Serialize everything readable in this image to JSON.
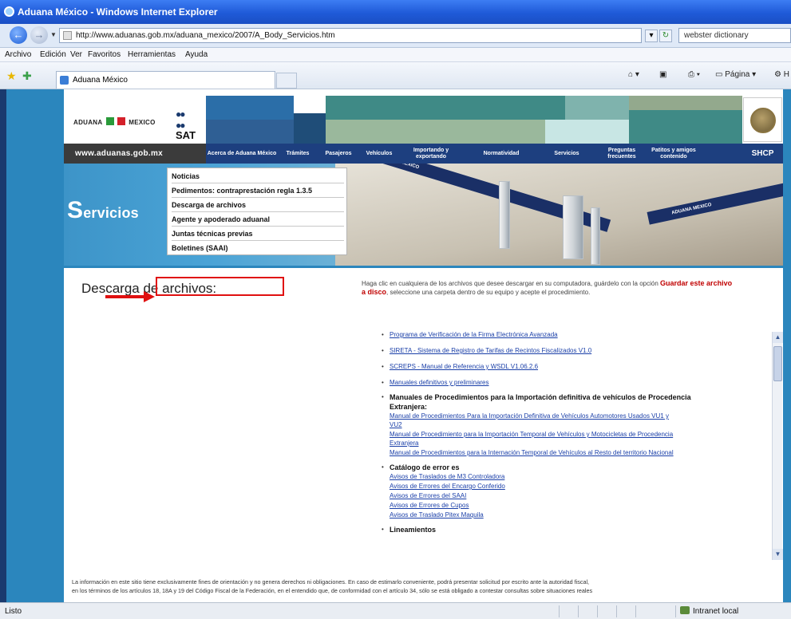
{
  "window": {
    "title": "Aduana México - Windows Internet Explorer"
  },
  "address": {
    "url": "http://www.aduanas.gob.mx/aduana_mexico/2007/A_Body_Servicios.htm",
    "search_value": "webster dictionary"
  },
  "menubar": [
    "Archivo",
    "Edición",
    "Ver",
    "Favoritos",
    "Herramientas",
    "Ayuda"
  ],
  "tab": {
    "label": "Aduana México"
  },
  "toolbar": {
    "page_label": "Página"
  },
  "site": {
    "logo_left": "ADUANA",
    "logo_right": "MEXICO",
    "sat_label": "SAT",
    "url_text": "www.aduanas.gob.mx",
    "shcp": "SHCP",
    "nav": [
      "Acerca de Aduana México",
      "Trámites",
      "Pasajeros",
      "Vehículos",
      "Importando y exportando",
      "Normatividad",
      "Servicios",
      "Preguntas frecuentes",
      "Patitos y amigos contenido"
    ],
    "banner_title_initial": "S",
    "banner_title_rest": "ervicios",
    "tape_text": "ADUANA MEXICO",
    "submenu": [
      "Noticias",
      "Pedimentos: contraprestación regla 1.3.5",
      "Descarga de archivos",
      "Agente y apoderado aduanal",
      "Juntas técnicas previas",
      "Boletines (SAAI)"
    ]
  },
  "content": {
    "heading": "Descarga de archivos:",
    "intro_before": "Haga clic en cualquiera de los archivos que desee descargar en su computadora, guárdelo con la opción",
    "intro_bold": "Guardar este archivo a disco",
    "intro_after": ", seleccione una carpeta dentro de su equipo y acepte el procedimiento.",
    "links": [
      "Programa de Verificación de la Firma Electrónica Avanzada",
      "SIRETA - Sistema de Registro de Tarifas de Recintos Fiscalizados V1.0",
      "SCREPS - Manual de Referencia y WSDL V1.06.2.6",
      "Manuales definitivos y preliminares"
    ],
    "section1": {
      "title": "Manuales de Procedimientos para la Importación definitiva de vehículos de Procedencia",
      "title_line2": "Extranjera:",
      "items": [
        "Manual de Procedimientos Para la Importación Definitiva de Vehículos Automotores Usados VU1 y",
        "VU2",
        "Manual de Procedimiento para la Importación Temporal de Vehículos y Motocicletas de Procedencia",
        "Extranjera",
        "Manual de Procedimientos para la Internación Temporal de Vehículos al Resto del territorio Nacional"
      ]
    },
    "section2": {
      "title": "Catálogo de error es",
      "items": [
        "Avisos de Traslados de M3 Controladora",
        "Avisos de Errores del Encargo Conferido",
        "Avisos de Errores del SAAI",
        "Avisos de Errores de Cupos",
        "Avisos de Traslado Pitex Maquila"
      ]
    },
    "section3": {
      "title": "Lineamientos"
    },
    "disclaimer_line1": "La información en este sitio tiene exclusivamente fines de orientación y no genera derechos ni obligaciones. En caso de estimarlo conveniente, podrá presentar solicitud por escrito ante la autoridad fiscal,",
    "disclaimer_line2": "en los términos de los artículos 18, 18A y 19 del Código Fiscal de la Federación, en el entendido que, de conformidad con el artículo 34, sólo se está obligado a contestar consultas sobre situaciones reales"
  },
  "status": {
    "left": "Listo",
    "zone": "Intranet local"
  },
  "colors": {
    "brand_blue": "#2b86bd",
    "nav_navy": "#1d3f7f",
    "highlight_red": "#e01010",
    "link_blue": "#1a3fa8"
  }
}
